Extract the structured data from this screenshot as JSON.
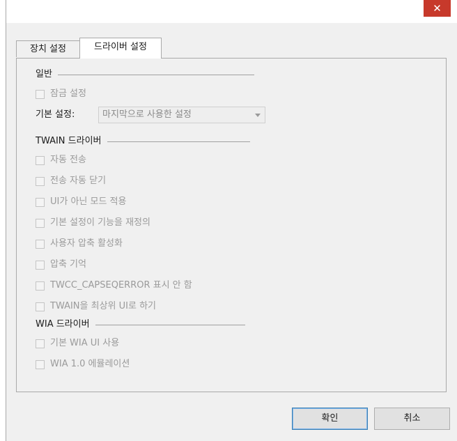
{
  "window": {
    "close_symbol": "✕"
  },
  "tabs": [
    {
      "label": "장치 설정",
      "active": false
    },
    {
      "label": "드라이버 설정",
      "active": true
    }
  ],
  "general": {
    "title": "일반",
    "lock_label": "잠금 설정",
    "preset_label": "기본 설정:",
    "preset_value": "마지막으로 사용한 설정"
  },
  "twain": {
    "title": "TWAIN 드라이버",
    "options": [
      "자동 전송",
      "전송 자동 닫기",
      "UI가 아닌 모드 적용",
      "기본 설정이 기능을 재정의",
      "사용자 압축 활성화",
      "압축 기억",
      "TWCC_CAPSEQERROR 표시 안 함",
      "TWAIN을 최상위 UI로 하기"
    ]
  },
  "wia": {
    "title": "WIA 드라이버",
    "options": [
      "기본 WIA UI 사용",
      "WIA 1.0 에뮬레이션"
    ]
  },
  "buttons": {
    "ok": "확인",
    "cancel": "취소"
  },
  "colors": {
    "close_bg": "#c7392b",
    "disabled_text": "#9a9a9a"
  }
}
